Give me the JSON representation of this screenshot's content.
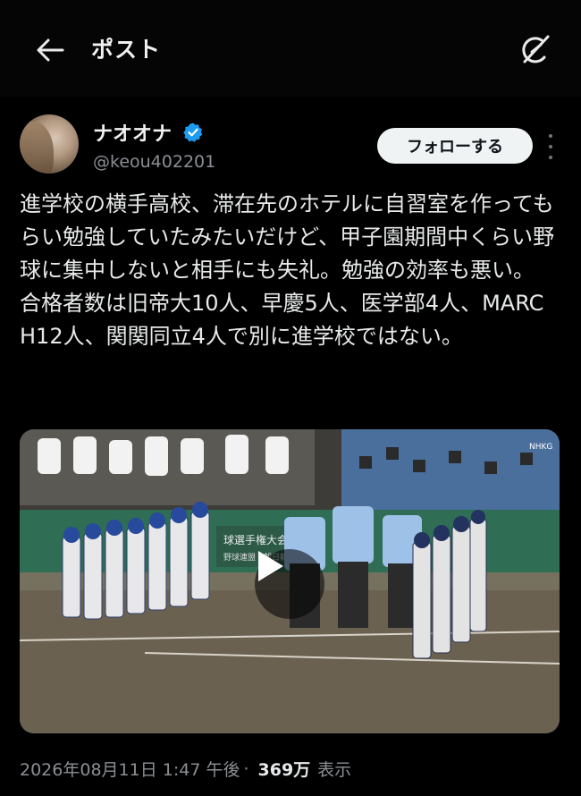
{
  "header": {
    "title": "ポスト",
    "back_icon": "arrow-left-icon",
    "grok_icon": "grok-icon"
  },
  "author": {
    "display_name": "ナオオナ",
    "handle": "@keou402201",
    "verified": true,
    "verified_color": "#1d9bf0",
    "follow_label": "フォローする"
  },
  "post": {
    "text": "進学校の横手高校、滞在先のホテルに自習室を作ってもらい勉強していたみたいだけど、甲子園期間中くらい野球に集中しないと相手にも失礼。勉強の効率も悪い。\n合格者数は旧帝大10人、早慶5人、医学部4人、MARCH12人、関関同立4人で別に進学校ではない。"
  },
  "media": {
    "type": "video",
    "banner_text": "球選手権大会",
    "banner_subtext": "野球連盟・朝日新聞社",
    "scoreboard_text": "NHKG"
  },
  "meta": {
    "timestamp": "2026年08月11日 1:47 午後",
    "separator": "·",
    "views": "369万",
    "views_label": "表示"
  },
  "colors": {
    "background": "#000000",
    "text": "#e7e9ea",
    "secondary": "#8b8f94",
    "follow_bg": "#eff3f4"
  }
}
